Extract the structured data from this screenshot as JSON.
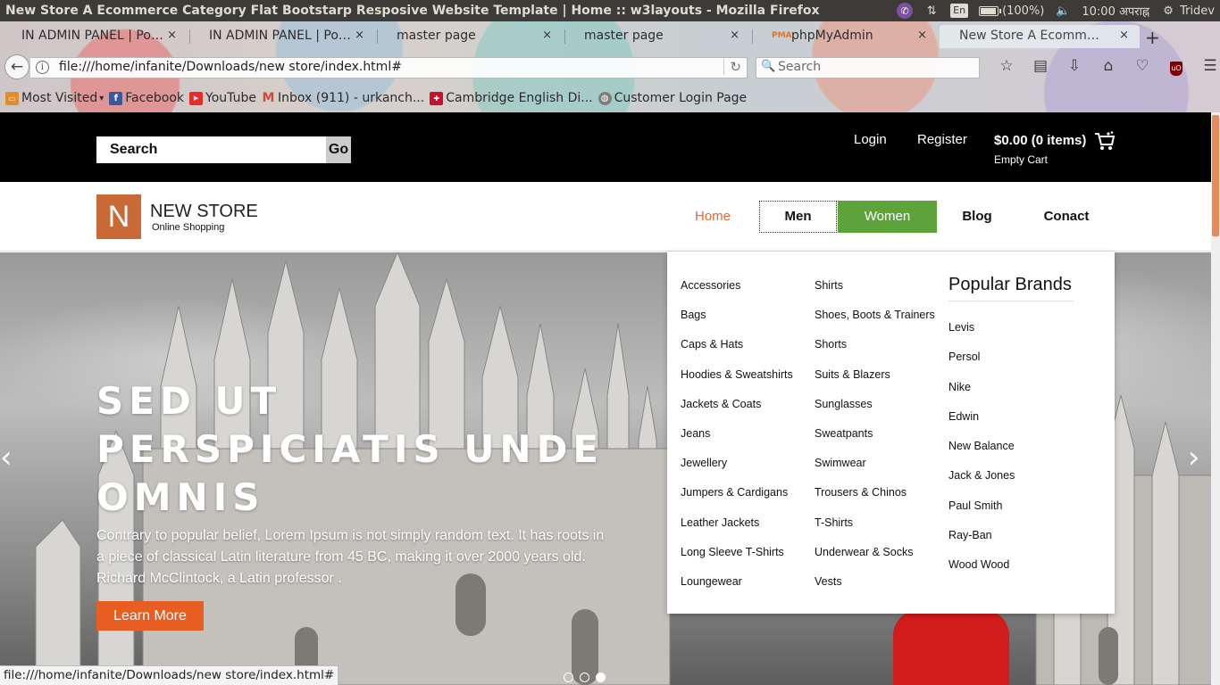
{
  "os": {
    "window_title": "New Store A Ecommerce Category Flat Bootstarp Resposive Website Template | Home :: w3layouts - Mozilla Firefox",
    "lang": "En",
    "battery": "(100%)",
    "battery_level": 1.0,
    "clock": "10:00 अपराह्न",
    "user": "Tridev"
  },
  "browser": {
    "tabs": [
      {
        "label": "IN ADMIN PANEL | Pow...",
        "active": false
      },
      {
        "label": "IN ADMIN PANEL | Pow...",
        "active": false
      },
      {
        "label": "master page",
        "active": false
      },
      {
        "label": "master page",
        "active": false
      },
      {
        "label": "phpMyAdmin",
        "active": false,
        "favicon": "PMA"
      },
      {
        "label": "New Store A Ecommer...",
        "active": true
      }
    ],
    "tab_close": "×",
    "new_tab": "+",
    "url": "file:///home/infanite/Downloads/new store/index.html#",
    "search_placeholder": "Search",
    "bookmarks": [
      {
        "label": "Most Visited",
        "icon": "folder-icon"
      },
      {
        "label": "Facebook",
        "icon": "facebook-icon"
      },
      {
        "label": "YouTube",
        "icon": "youtube-icon"
      },
      {
        "label": "Inbox (911) - urkanch...",
        "icon": "gmail-icon"
      },
      {
        "label": "Cambridge English Di...",
        "icon": "cambridge-icon"
      },
      {
        "label": "Customer Login Page",
        "icon": "globe-icon"
      }
    ],
    "status_url": "file:///home/infanite/Downloads/new store/index.html#"
  },
  "site": {
    "search_placeholder": "Search",
    "search_go": "Go",
    "login": "Login",
    "register": "Register",
    "cart_total": "$0.00 (0 items)",
    "cart_empty": "Empty Cart",
    "logo_letter": "N",
    "logo_name": "NEW STORE",
    "logo_tagline": "Online Shopping",
    "nav": {
      "home": "Home",
      "men": "Men",
      "women": "Women",
      "blog": "Blog",
      "contact": "Conact"
    },
    "hero": {
      "title_lines": [
        "SED UT",
        "PERSPICIATIS UNDE",
        "OMNIS"
      ],
      "description": "Contrary to popular belief, Lorem Ipsum is not simply random text. It has roots in a piece of classical Latin literature from 45 BC, making it over 2000 years old. Richard McClintock, a Latin professor .",
      "button": "Learn More",
      "prev_arrow": "‹",
      "next_arrow": "›",
      "slides": 3,
      "active_slide": 3
    },
    "mega_menu": {
      "col1": [
        "Accessories",
        "Bags",
        "Caps & Hats",
        "Hoodies & Sweatshirts",
        "Jackets & Coats",
        "Jeans",
        "Jewellery",
        "Jumpers & Cardigans",
        "Leather Jackets",
        "Long Sleeve T-Shirts",
        "Loungewear"
      ],
      "col2": [
        "Shirts",
        "Shoes, Boots & Trainers",
        "Shorts",
        "Suits & Blazers",
        "Sunglasses",
        "Sweatpants",
        "Swimwear",
        "Trousers & Chinos",
        "T-Shirts",
        "Underwear & Socks",
        "Vests"
      ],
      "brands_title": "Popular Brands",
      "brands": [
        "Levis",
        "Persol",
        "Nike",
        "Edwin",
        "New Balance",
        "Jack & Jones",
        "Paul Smith",
        "Ray-Ban",
        "Wood Wood"
      ]
    }
  },
  "colors": {
    "accent_orange": "#e4692b",
    "women_green": "#5ea23b",
    "logo_brown": "#c96a36",
    "button_orange": "#e85d21"
  }
}
